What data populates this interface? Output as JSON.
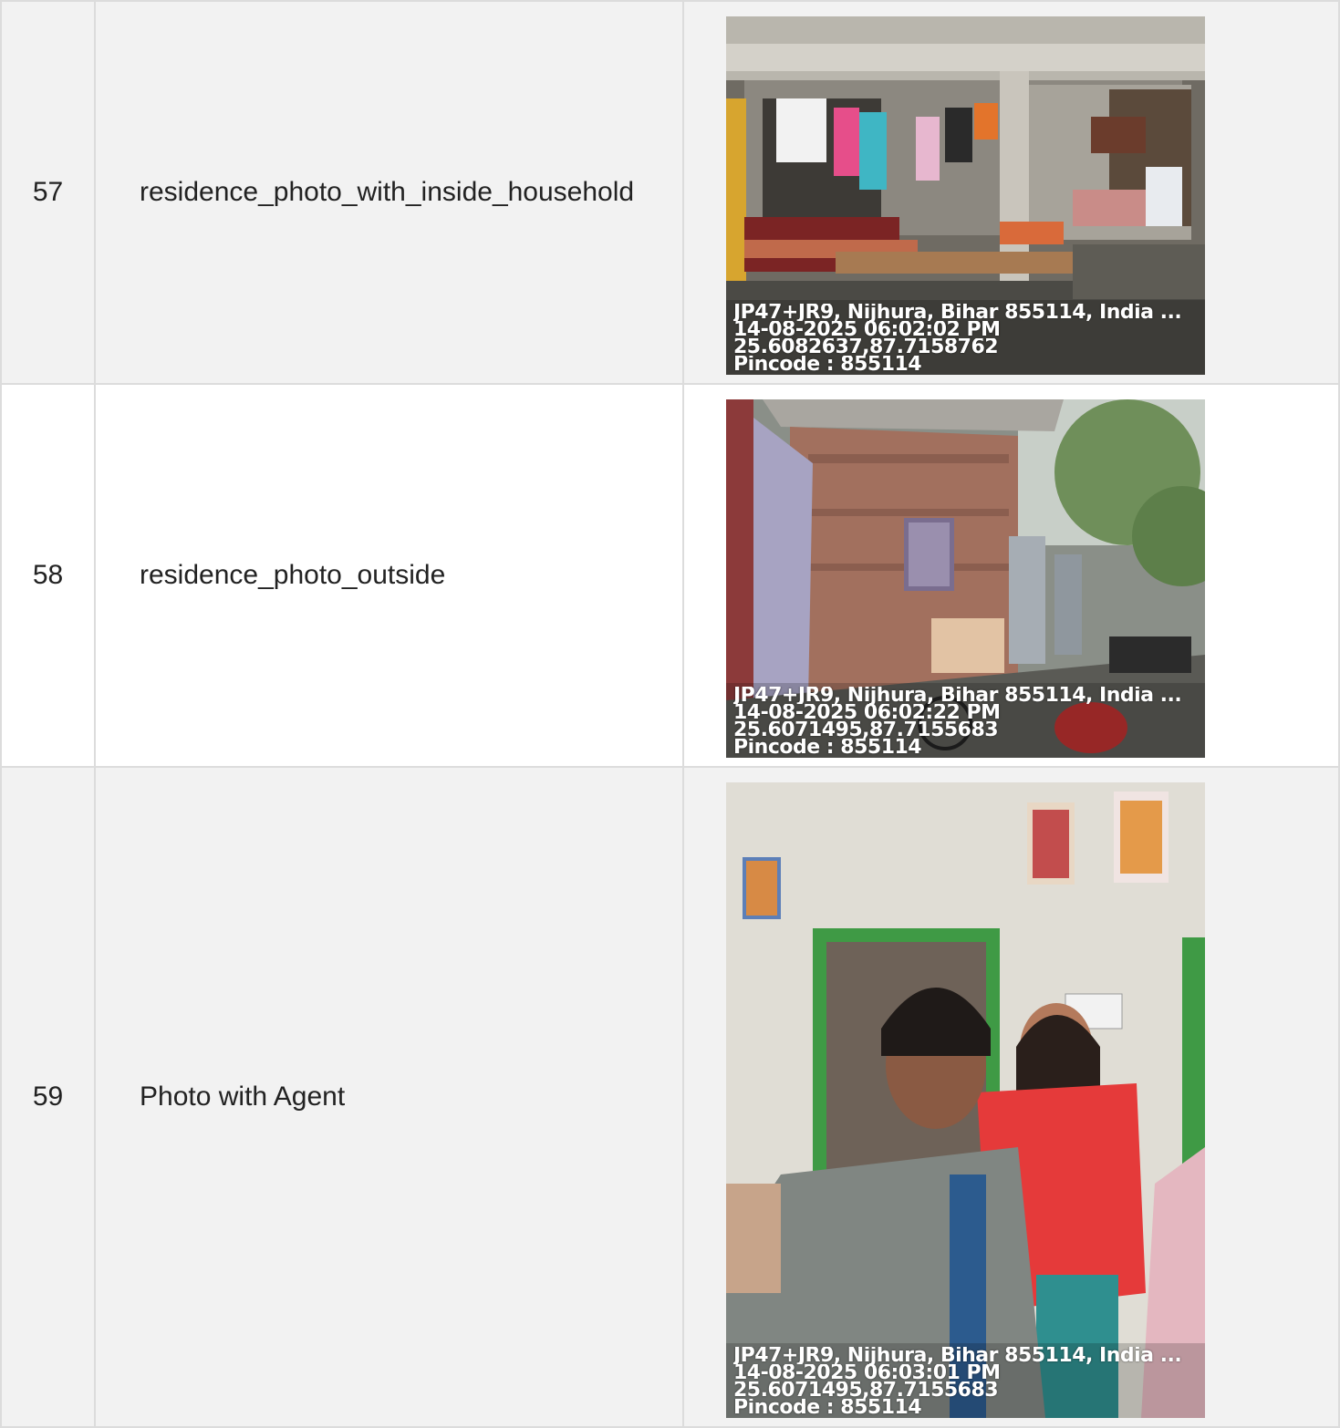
{
  "rows": [
    {
      "number": "57",
      "name": "residence_photo_with_inside_household",
      "photo": {
        "description": "veranda",
        "stamp": {
          "address": "JP47+JR9, Nijhura, Bihar 855114, India ...",
          "datetime": "14-08-2025 06:02:02 PM",
          "coordinates": "25.6082637,87.7158762",
          "pincode": "Pincode : 855114"
        }
      }
    },
    {
      "number": "58",
      "name": "residence_photo_outside",
      "photo": {
        "description": "lane",
        "stamp": {
          "address": "JP47+JR9, Nijhura, Bihar 855114, India ...",
          "datetime": "14-08-2025 06:02:22 PM",
          "coordinates": "25.6071495,87.7155683",
          "pincode": "Pincode : 855114"
        }
      }
    },
    {
      "number": "59",
      "name": "Photo with Agent",
      "photo": {
        "description": "selfie",
        "stamp": {
          "address": "JP47+JR9, Nijhura, Bihar 855114, India ...",
          "datetime": "14-08-2025 06:03:01 PM",
          "coordinates": "25.6071495,87.7155683",
          "pincode": "Pincode : 855114"
        }
      }
    }
  ]
}
